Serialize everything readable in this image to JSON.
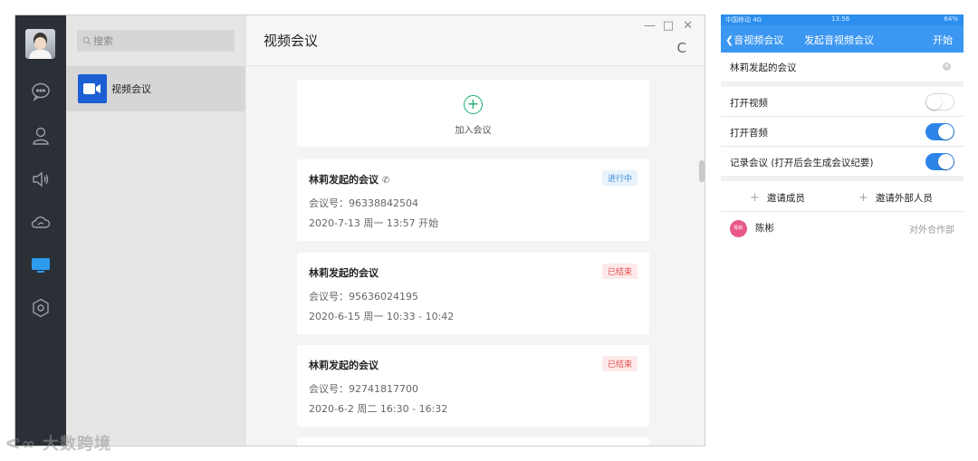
{
  "desktop": {
    "sidebar": {
      "icons": [
        "chat-icon",
        "contacts-icon",
        "announcement-icon",
        "cloud-disk-icon",
        "meeting-icon",
        "settings-icon"
      ],
      "active_color": "#2d9cf0"
    },
    "search": {
      "placeholder": "搜索"
    },
    "conversation": {
      "label": "视频会议"
    },
    "main": {
      "title": "视频会议",
      "window_controls": [
        "—",
        "□",
        "✕"
      ],
      "refresh_glyph": "C",
      "join": {
        "plus": "+",
        "label": "加入会议"
      },
      "meetings": [
        {
          "title": "林莉发起的会议",
          "status": "进行中",
          "id_label": "会议号：96338842504",
          "time": "2020-7-13 周一 13:57 开始",
          "phone": true
        },
        {
          "title": "林莉发起的会议",
          "status": "已结束",
          "id_label": "会议号：95636024195",
          "time": "2020-6-15 周一 10:33 - 10:42",
          "phone": false
        },
        {
          "title": "林莉发起的会议",
          "status": "已结束",
          "id_label": "会议号：92741817700",
          "time": "2020-6-2 周二 16:30 - 16:32",
          "phone": false
        }
      ]
    }
  },
  "phone": {
    "status_bar": {
      "carrier": "中国移动 4G",
      "time": "13:56",
      "battery": "64%"
    },
    "nav": {
      "back_label": "音视频会议",
      "title": "发起音视频会议",
      "start_label": "开始"
    },
    "meeting_name": "林莉发起的会议",
    "options": [
      {
        "label": "打开视频",
        "on": false
      },
      {
        "label": "打开音频",
        "on": true
      },
      {
        "label": "记录会议 (打开后会生成会议纪要)",
        "on": true
      }
    ],
    "invite_members": "邀请成员",
    "invite_external": "邀请外部人员",
    "member": {
      "avatar_text": "陈彬",
      "name": "陈彬",
      "tag": "对外合作部"
    },
    "accent_color": "#3b97f1"
  },
  "watermark": "大数跨境"
}
